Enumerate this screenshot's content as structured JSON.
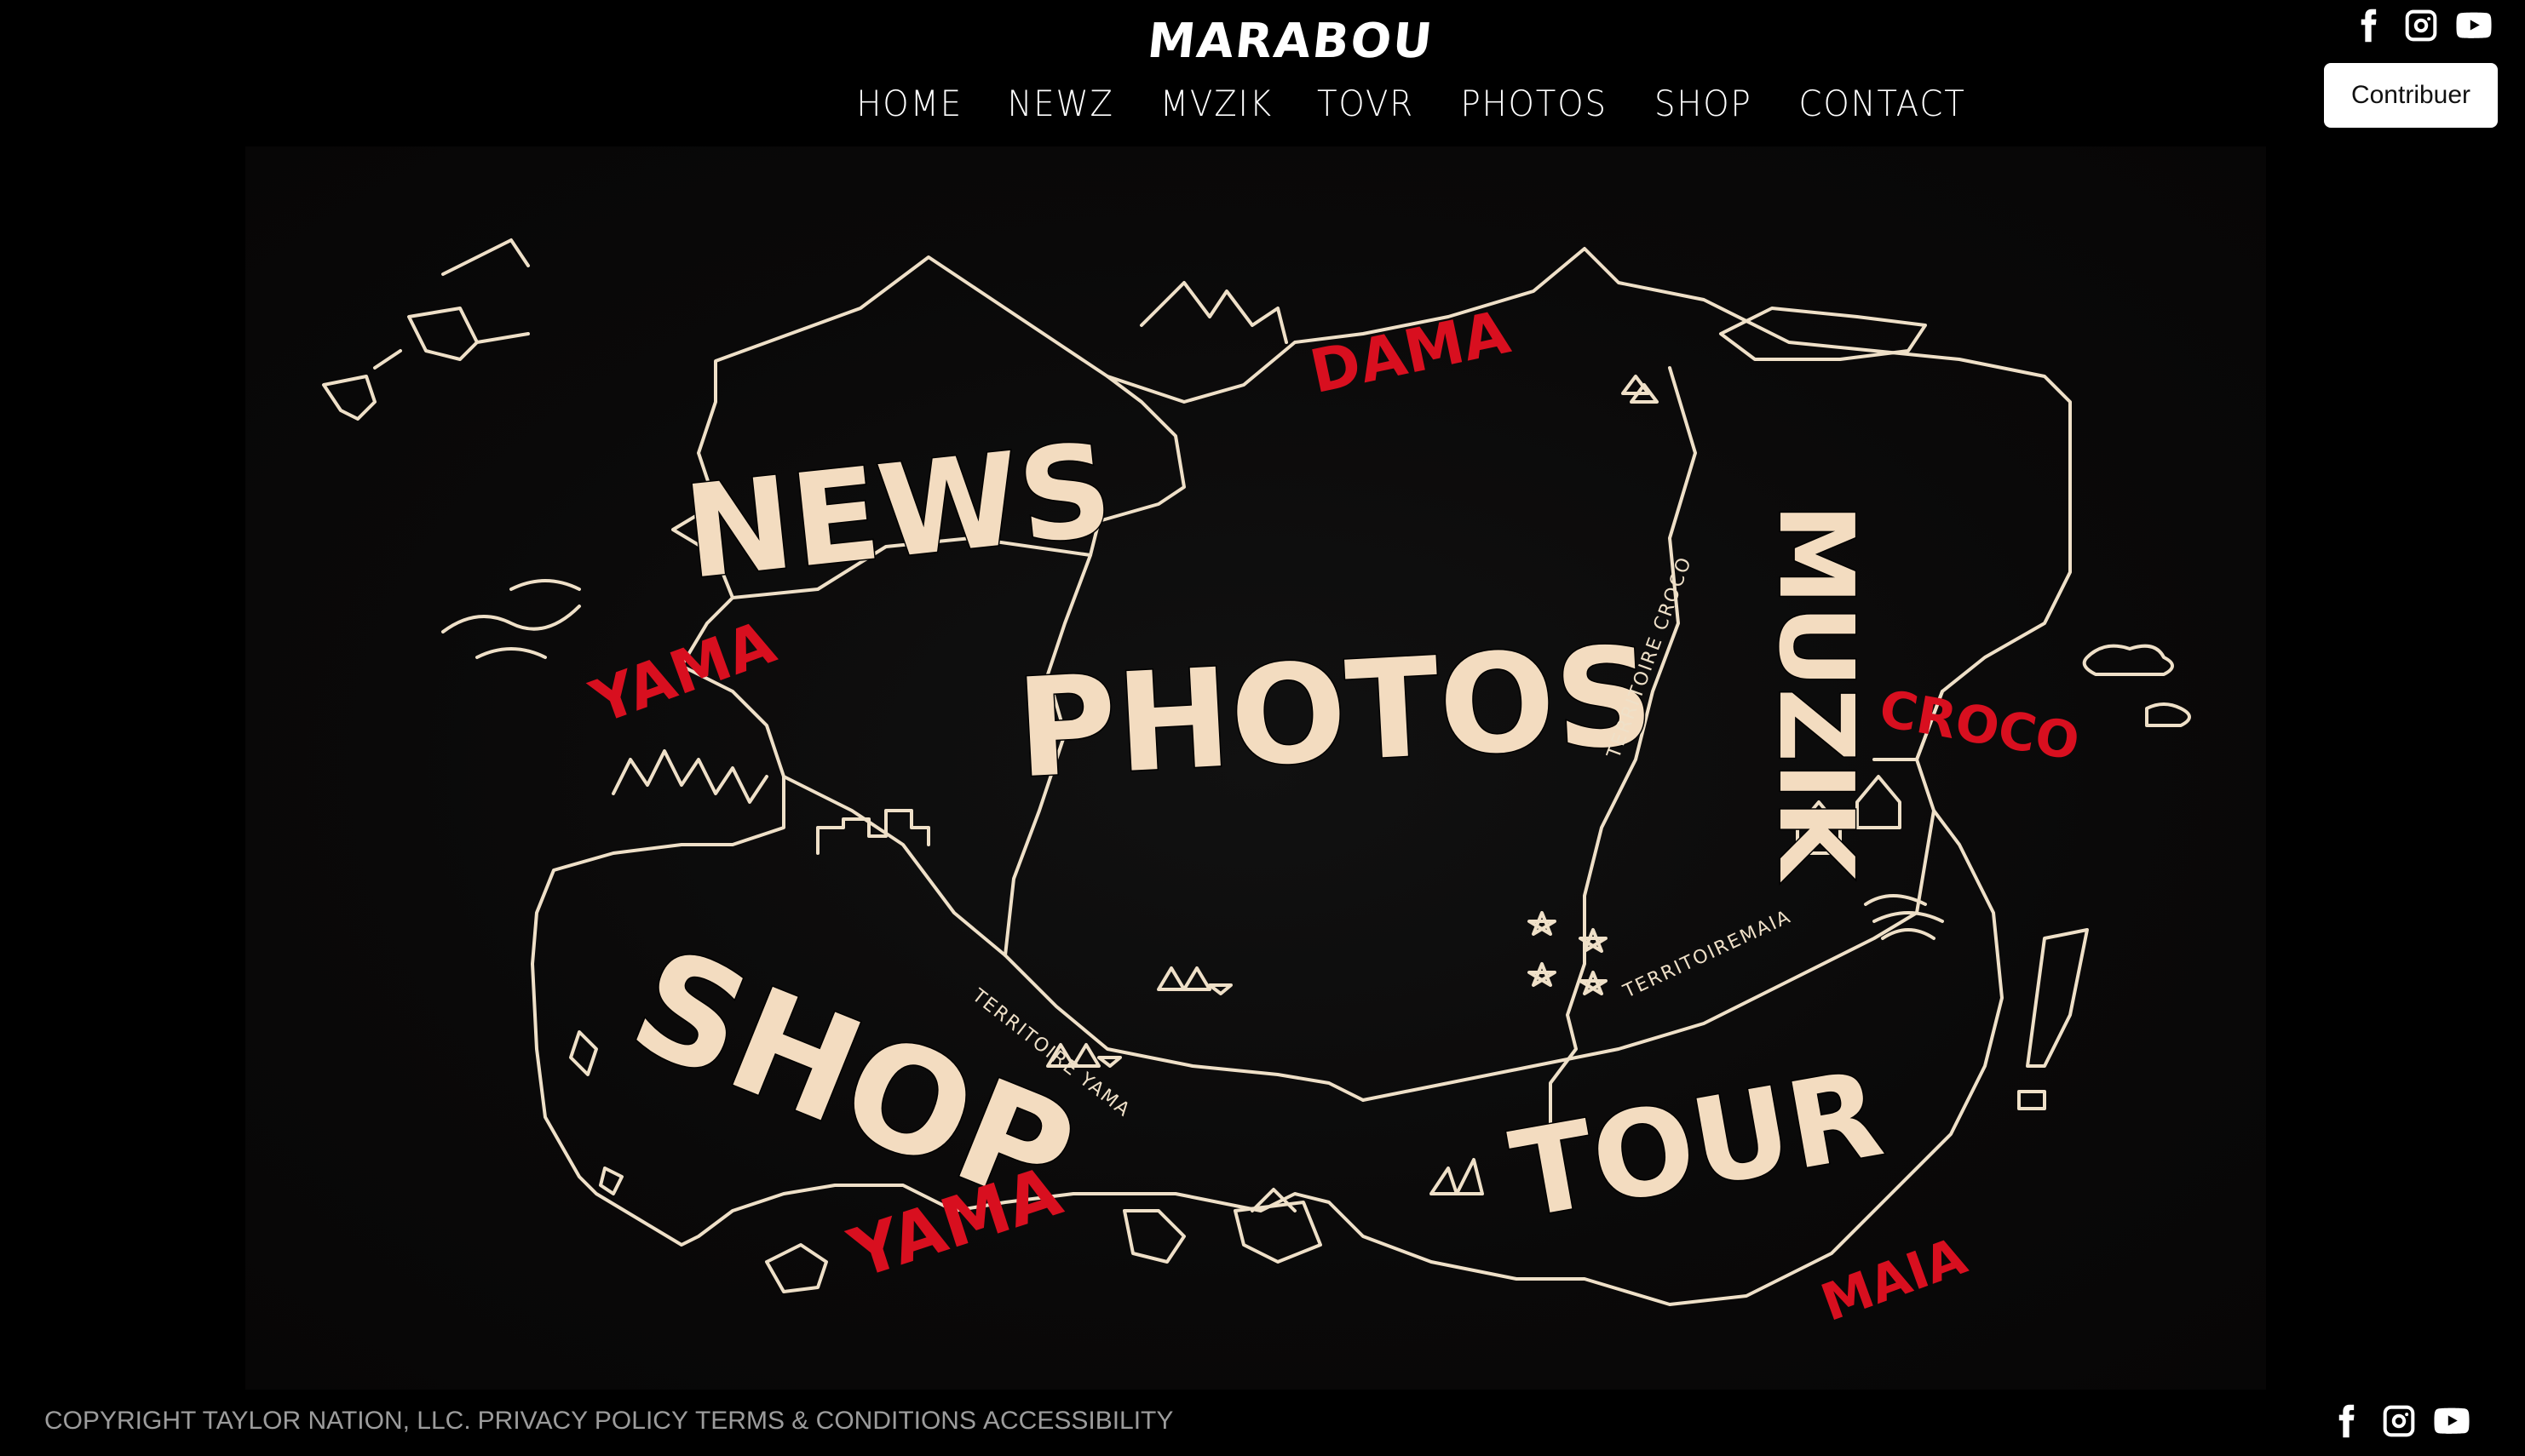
{
  "header": {
    "logo": "MARABOU",
    "nav": [
      {
        "label": "HOME"
      },
      {
        "label": "NEWZ"
      },
      {
        "label": "MVZIK"
      },
      {
        "label": "TOVR"
      },
      {
        "label": "PHOTOS"
      },
      {
        "label": "SHOP"
      },
      {
        "label": "CONTACT"
      }
    ],
    "social": [
      "facebook-icon",
      "instagram-icon",
      "youtube-icon"
    ],
    "contribute_label": "Contribuer"
  },
  "map": {
    "regions": {
      "news": "NEWS",
      "photos": "PHOTOS",
      "muzik": "MUZIK",
      "shop": "SHOP",
      "tour": "TOUR"
    },
    "territories": {
      "dama": "DAMA",
      "yama_top": "YAMA",
      "yama_bottom": "YAMA",
      "croco": "CROCO",
      "maia": "MAIA"
    },
    "small_labels": {
      "territoire_yama": "TERRITOIRE YAMA",
      "territoire_croco": "TERRITOIRE CROCO",
      "territoire_maia": "TERRITOIREMAIA"
    }
  },
  "footer": {
    "links": [
      {
        "label": "COPYRIGHT TAYLOR NATION, LLC."
      },
      {
        "label": "PRIVACY POLICY"
      },
      {
        "label": "TERMS & CONDITIONS"
      },
      {
        "label": "ACCESSIBILITY"
      }
    ],
    "social": [
      "facebook-icon",
      "instagram-icon",
      "youtube-icon"
    ]
  },
  "colors": {
    "background": "#000000",
    "map_ink": "#efe0c8",
    "territory_red": "#d80f1f",
    "label_fill": "#f3dcc0",
    "footer_text": "#9c9c9c"
  }
}
